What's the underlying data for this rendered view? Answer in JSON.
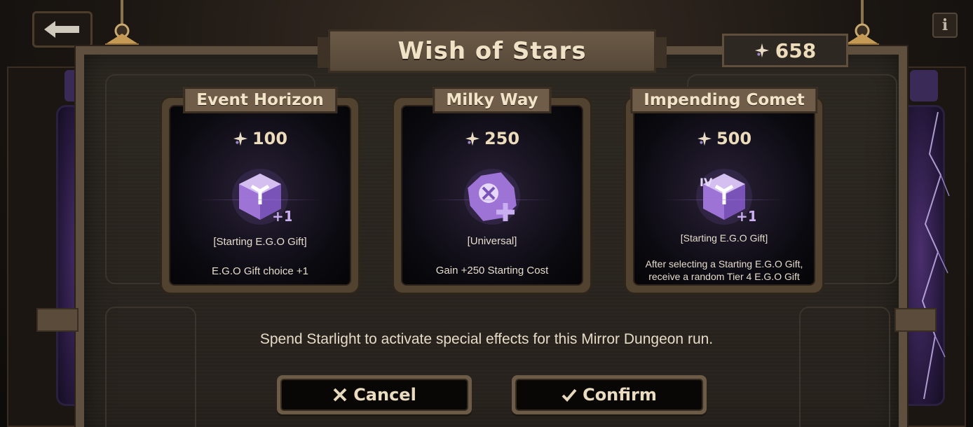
{
  "dialog": {
    "title": "Wish of Stars",
    "starlight_total": "658",
    "hint": "Spend Starlight to activate special effects for this Mirror Dungeon run."
  },
  "cards": [
    {
      "title": "Event Horizon",
      "cost": "100",
      "type": "[Starting E.G.O Gift]",
      "description": "E.G.O Gift choice +1",
      "icon": "ego-gift-cube-plus-one-icon"
    },
    {
      "title": "Milky Way",
      "cost": "250",
      "type": "[Universal]",
      "description": "Gain +250 Starting Cost",
      "icon": "starting-cost-plus-icon"
    },
    {
      "title": "Impending Comet",
      "cost": "500",
      "type": "[Starting E.G.O Gift]",
      "description": "After selecting a Starting E.G.O Gift, receive a random Tier 4 E.G.O Gift",
      "icon": "tier-iv-gift-cube-icon"
    }
  ],
  "buttons": {
    "cancel": "Cancel",
    "confirm": "Confirm"
  },
  "colors": {
    "gift_purple": "#b48ae6",
    "text_cream": "#ecdcbb",
    "frame_brown": "#6c5c47"
  }
}
